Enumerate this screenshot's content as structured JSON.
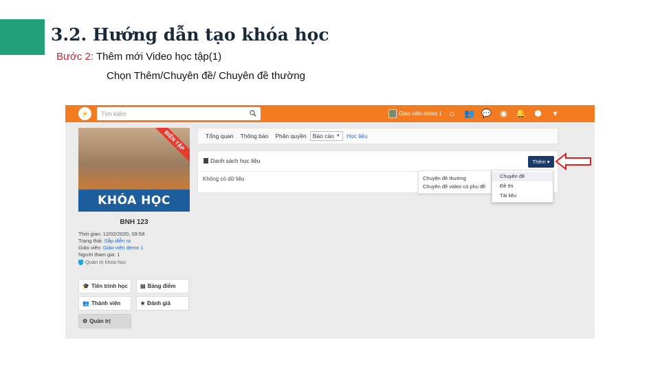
{
  "slide": {
    "title": "3.2. Hướng dẫn tạo khóa học",
    "step_label": "Bước 2:",
    "step_text": " Thêm mới Video học tập(1)",
    "instruction": "Chọn Thêm/Chuyên đề/ Chuyên đề thường",
    "accent_color": "#21a07a",
    "step_color": "#c9252b"
  },
  "app": {
    "brand_color": "#f37b21",
    "search": {
      "placeholder": "Tìm kiếm",
      "icon": "search-icon"
    },
    "user": {
      "name": "Giáo viên demo 1"
    },
    "top_icons": [
      "home-icon",
      "users-icon",
      "chat-icon",
      "globe-icon",
      "bell-icon",
      "cube-icon",
      "caret-down-icon"
    ],
    "course": {
      "ribbon": "BIÊN TẬP",
      "banner": "KHÓA HỌC",
      "code": "BNH 123",
      "info": [
        {
          "label": "Thời gian: ",
          "value": "12/02/2020, 09:58"
        },
        {
          "label": "Trạng thái: ",
          "value": "Sắp diễn ra"
        },
        {
          "label": "Giáo viên: ",
          "value": "Giáo viên demo 1"
        },
        {
          "label": "Người tham gia: ",
          "value": "1"
        }
      ],
      "manage_link": "Quản trị khóa học"
    },
    "left_buttons": {
      "progress": "Tiến trình học",
      "grades": "Bảng điểm",
      "members": "Thành viên",
      "review": "Đánh giá",
      "admin": "Quản trị"
    },
    "tabs": {
      "overview": "Tổng quan",
      "notice": "Thông báo",
      "permission": "Phân quyền",
      "report": "Báo cáo",
      "material": "Học liệu"
    },
    "panel": {
      "title": "Danh sách học liệu",
      "empty": "Không có dữ liệu",
      "add_button": "Thêm"
    },
    "submenu": [
      "Chuyên đề thường",
      "Chuyên đề video có phụ đề"
    ],
    "dropdown": [
      "Chuyên đề",
      "Đề thi",
      "Tài liệu"
    ]
  }
}
